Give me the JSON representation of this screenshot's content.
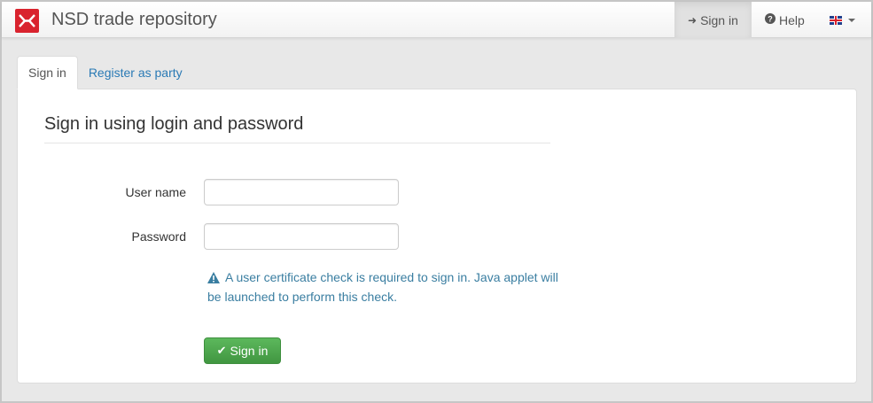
{
  "colors": {
    "brand": "#d9232e",
    "link": "#2a7ab5",
    "hint": "#3a7ea1",
    "success": "#5cb85c"
  },
  "navbar": {
    "brand": "NSD trade repository",
    "logo_icon": "nsd-logo-icon",
    "sign_in": "Sign in",
    "sign_in_icon": "sign-in-icon",
    "help": "Help",
    "help_icon": "question-circle-icon",
    "language_icon": "uk-flag-icon"
  },
  "tabs": [
    {
      "label": "Sign in",
      "active": true
    },
    {
      "label": "Register as party",
      "active": false
    }
  ],
  "form": {
    "title": "Sign in using login and password",
    "username_label": "User name",
    "username_value": "",
    "password_label": "Password",
    "password_value": "",
    "hint_icon": "warning-triangle-icon",
    "hint": "A user certificate check is required to sign in. Java applet will be launched to perform this check.",
    "submit": "Sign in",
    "submit_icon": "check-icon"
  }
}
